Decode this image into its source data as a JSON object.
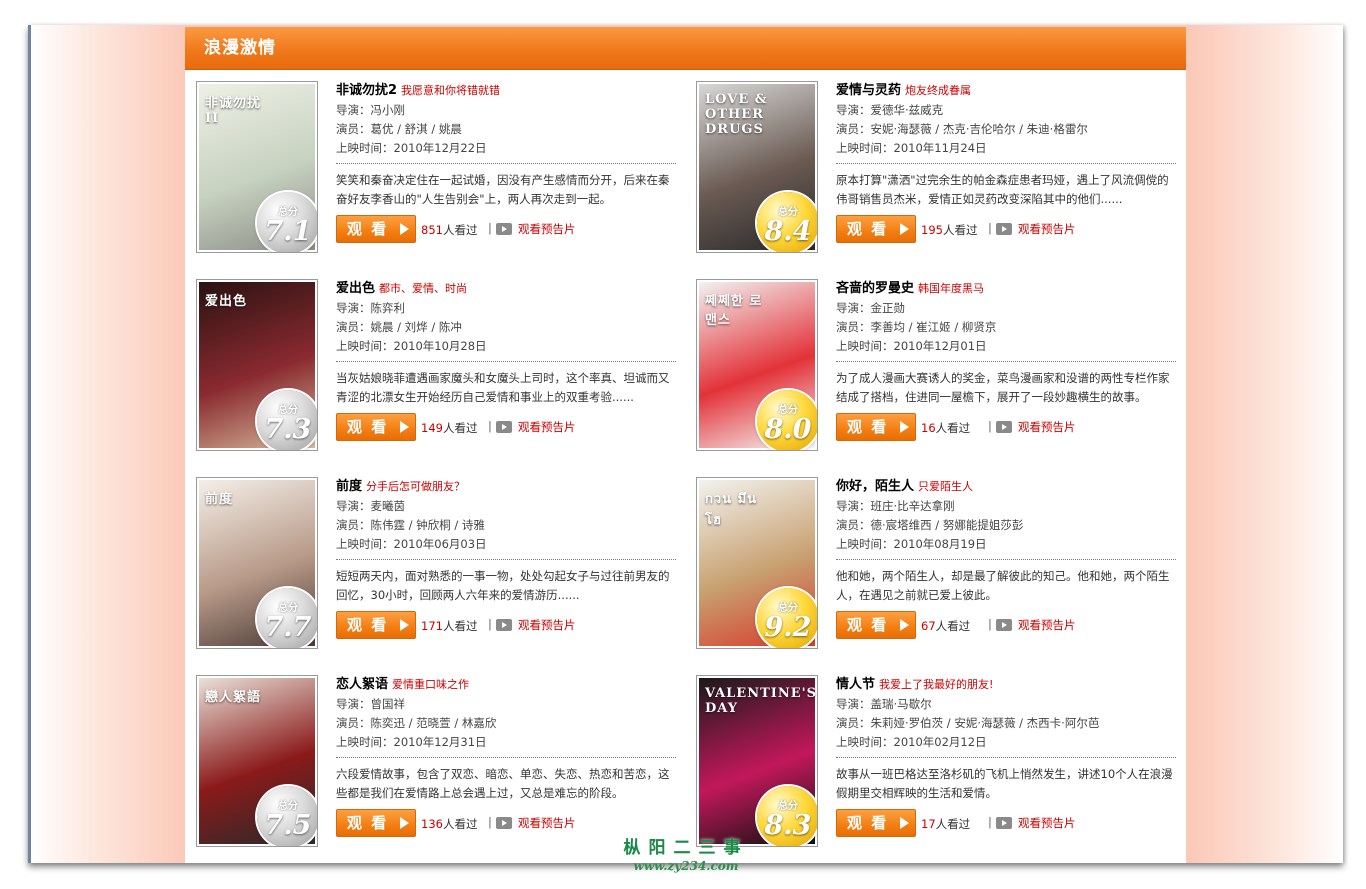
{
  "panel": {
    "title": "浪漫激情"
  },
  "ui": {
    "watch_label": "观 看",
    "trailer_label": "观看预告片",
    "views_suffix": "人看过",
    "score_label": "总分",
    "pipe": "|"
  },
  "movies": [
    {
      "title": "非诚勿扰2",
      "tagline": "我愿意和你将错就错",
      "director": "导演：冯小刚",
      "cast": "演员：葛优 / 舒淇 / 姚晨",
      "release": "上映时间：2010年12月22日",
      "desc": "笑笑和秦奋决定住在一起试婚，因没有产生感情而分开，后来在秦奋好友李香山的\"人生告别会\"上，两人再次走到一起。",
      "score": "7.1",
      "badge": "silver",
      "views": "851",
      "poster_colors": [
        "#eef0e6",
        "#c7d2c0",
        "#8c8d86"
      ],
      "poster_text": "非诚勿扰II"
    },
    {
      "title": "爱情与灵药",
      "tagline": "炮友终成眷属",
      "director": "导演：爱德华·兹威克",
      "cast": "演员：安妮·海瑟薇 / 杰克·吉伦哈尔 / 朱迪·格雷尔",
      "release": "上映时间：2010年11月24日",
      "desc": "原本打算\"潇洒\"过完余生的帕金森症患者玛娅，遇上了风流倜傥的伟哥销售员杰米，爱情正如灵药改变深陷其中的他们......",
      "score": "8.4",
      "badge": "gold",
      "views": "195",
      "poster_colors": [
        "#d8d8d8",
        "#6a5a52",
        "#2a2a2a"
      ],
      "poster_text": "LOVE & OTHER DRUGS"
    },
    {
      "title": "爱出色",
      "tagline": "都市、爱情、时尚",
      "director": "导演：陈弈利",
      "cast": "演员：姚晨 / 刘烨 / 陈冲",
      "release": "上映时间：2010年10月28日",
      "desc": "当灰姑娘晓菲遭遇画家魔头和女魔头上司时，这个率真、坦诚而又青涩的北漂女生开始经历自己爱情和事业上的双重考验......",
      "score": "7.3",
      "badge": "silver",
      "views": "149",
      "poster_colors": [
        "#2b1212",
        "#8a2a30",
        "#d5b89a"
      ],
      "poster_text": "爱出色"
    },
    {
      "title": "吝啬的罗曼史",
      "tagline": "韩国年度黑马",
      "director": "导演：金正勋",
      "cast": "演员：李善均 / 崔江姬 / 柳贤京",
      "release": "上映时间：2010年12月01日",
      "desc": "为了成人漫画大赛诱人的奖金，菜鸟漫画家和没谱的两性专栏作家结成了搭档，住进同一屋檐下，展开了一段妙趣横生的故事。",
      "score": "8.0",
      "badge": "gold",
      "views": "16",
      "poster_colors": [
        "#f2f2f2",
        "#e23238",
        "#f6f6f6"
      ],
      "poster_text": "쩨쩨한 로맨스"
    },
    {
      "title": "前度",
      "tagline": "分手后怎可做朋友？",
      "director": "导演：麦曦茵",
      "cast": "演员：陈伟霆 / 钟欣桐 / 诗雅",
      "release": "上映时间：2010年06月03日",
      "desc": "短短两天内，面对熟悉的一事一物，处处勾起女子与过往前男友的回忆，30小时，回顾两人六年来的爱情游历......",
      "score": "7.7",
      "badge": "silver",
      "views": "171",
      "poster_colors": [
        "#f4efe9",
        "#b89a88",
        "#4a3a36"
      ],
      "poster_text": "前度"
    },
    {
      "title": "你好，陌生人",
      "tagline": "只爱陌生人",
      "director": "导演：班庄·比辛达拿刚",
      "cast": "演员：德·宸塔维西 / 努娜能提姐莎彭",
      "release": "上映时间：2010年08月19日",
      "desc": "他和她，两个陌生人，却是最了解彼此的知己。他和她，两个陌生人，在遇见之前就已爱上彼此。",
      "score": "9.2",
      "badge": "gold",
      "views": "67",
      "poster_colors": [
        "#f2f2ee",
        "#c8a070",
        "#d63a2a"
      ],
      "poster_text": "กวน มึน โฮ"
    },
    {
      "title": "恋人絮语",
      "tagline": "爱情重口味之作",
      "director": "导演：曾国祥",
      "cast": "演员：陈奕迅 / 范晓萱 / 林嘉欣",
      "release": "上映时间：2010年12月31日",
      "desc": "六段爱情故事，包含了双恋、暗恋、单恋、失恋、热恋和苦恋，这些都是我们在爱情路上总会遇上过，又总是难忘的阶段。",
      "score": "7.5",
      "badge": "silver",
      "views": "136",
      "poster_colors": [
        "#e9e2d8",
        "#8a1a1a",
        "#2a2a2a"
      ],
      "poster_text": "戀人絮語"
    },
    {
      "title": "情人节",
      "tagline": "我爱上了我最好的朋友!",
      "director": "导演：盖瑞·马歇尔",
      "cast": "演员：朱莉娅·罗伯茨 / 安妮·海瑟薇 / 杰西卡·阿尔芭",
      "release": "上映时间：2010年02月12日",
      "desc": "故事从一班巴格达至洛杉矶的飞机上悄然发生，讲述10个人在浪漫假期里交相辉映的生活和爱情。",
      "score": "8.3",
      "badge": "gold",
      "views": "17",
      "poster_colors": [
        "#1a1a1a",
        "#c2185b",
        "#111111"
      ],
      "poster_text": "VALENTINE'S DAY"
    }
  ],
  "watermark": {
    "cn": "枞阳二三事",
    "url": "www.zy234.com"
  }
}
